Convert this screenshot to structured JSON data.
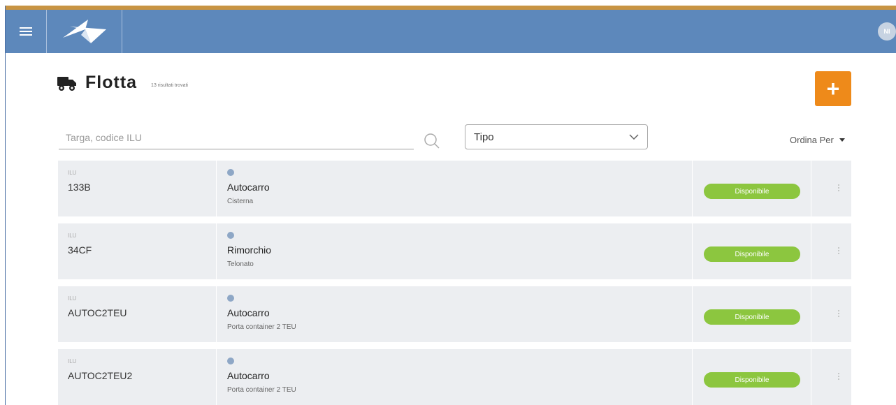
{
  "header": {
    "menu_icon": "hamburger-icon",
    "logo_icon": "paper-plane-logo",
    "avatar_initials": "NI"
  },
  "page": {
    "title": "Flotta",
    "subtitle": "13 risultati trovati",
    "title_icon": "truck-icon",
    "add_label": "+",
    "accent_color": "#ee8a1a"
  },
  "filters": {
    "search_placeholder": "Targa, codice ILU",
    "type_select_label": "Tipo",
    "sort_label": "Ordina Per"
  },
  "rows": [
    {
      "ilu_label": "ILU",
      "code": "133B",
      "type": "Autocarro",
      "subtype": "Cisterna",
      "status": "Disponibile"
    },
    {
      "ilu_label": "ILU",
      "code": "34CF",
      "type": "Rimorchio",
      "subtype": "Telonato",
      "status": "Disponibile"
    },
    {
      "ilu_label": "ILU",
      "code": "AUTOC2TEU",
      "type": "Autocarro",
      "subtype": "Porta container 2 TEU",
      "status": "Disponibile"
    },
    {
      "ilu_label": "ILU",
      "code": "AUTOC2TEU2",
      "type": "Autocarro",
      "subtype": "Porta container 2 TEU",
      "status": "Disponibile"
    }
  ],
  "colors": {
    "topbar": "#5d88bb",
    "status_available": "#8cc63f",
    "row_background": "#eceef1"
  }
}
